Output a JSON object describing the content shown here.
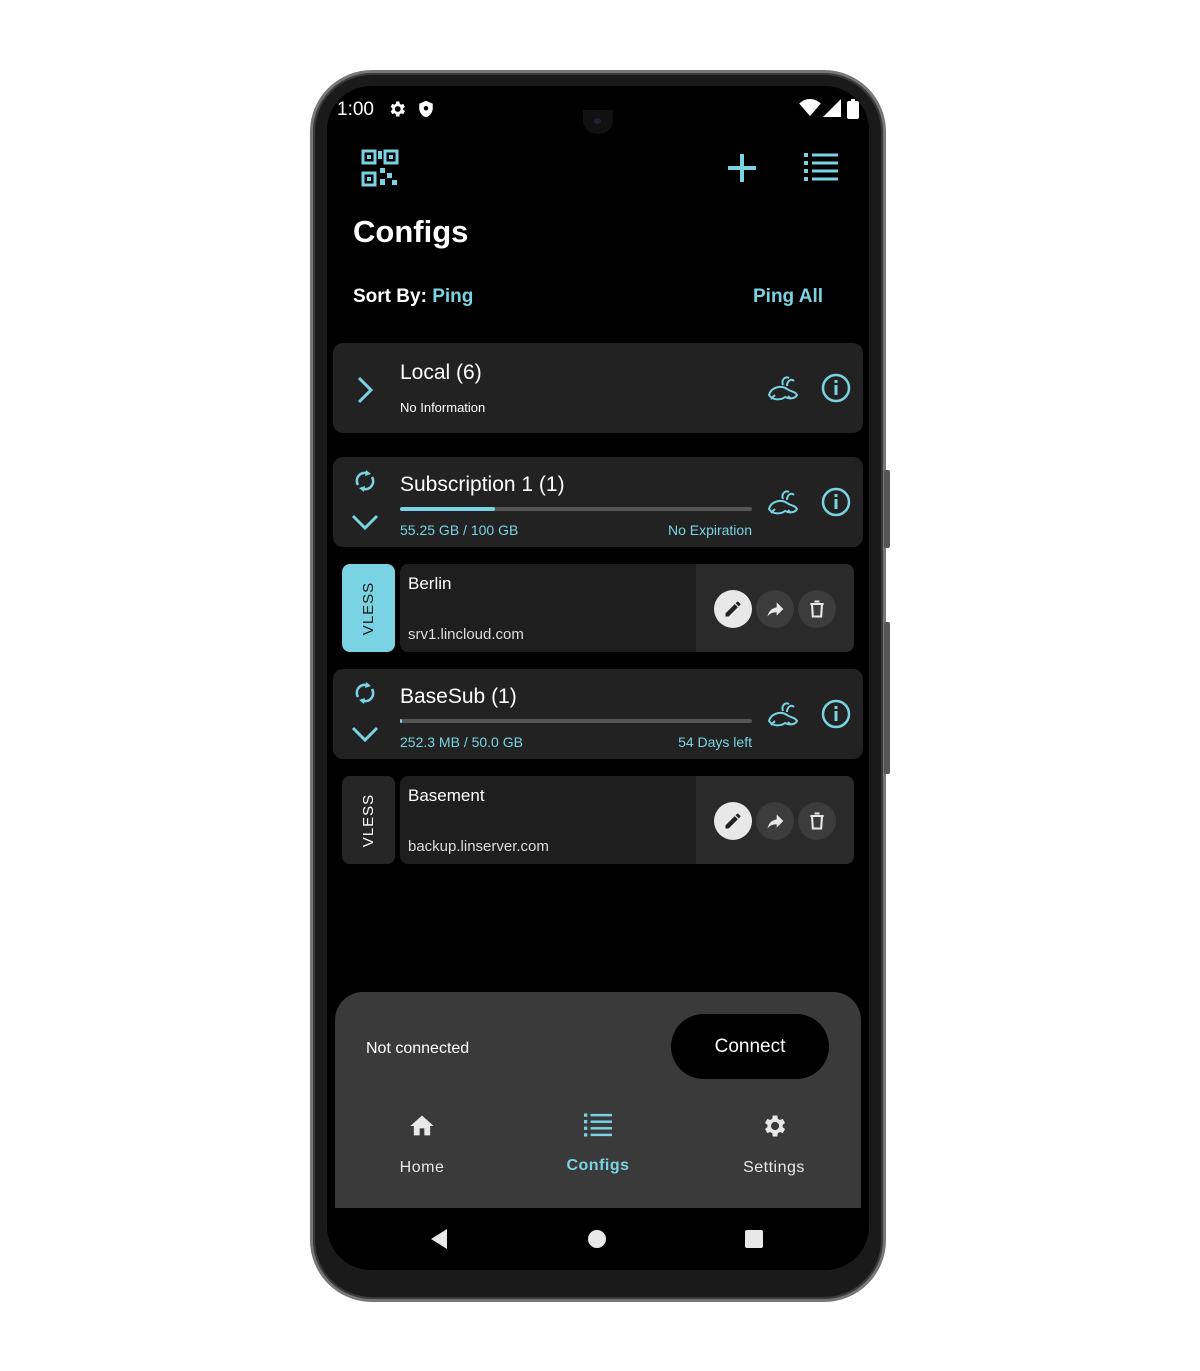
{
  "status_bar": {
    "time": "1:00"
  },
  "header": {
    "title": "Configs",
    "sort_label": "Sort By:",
    "sort_value": "Ping",
    "ping_all": "Ping All"
  },
  "icons": {
    "qr": "qr-code-icon",
    "add": "plus-icon",
    "list": "list-icon",
    "expand": "chevron-right-icon",
    "collapse": "chevron-down-icon",
    "refresh": "refresh-icon",
    "ping": "rabbit-icon",
    "info": "info-icon",
    "edit": "pencil-icon",
    "share": "share-icon",
    "delete": "trash-icon"
  },
  "groups": [
    {
      "name": "Local (6)",
      "info": "No Information"
    },
    {
      "name": "Subscription 1 (1)",
      "usage": "55.25 GB / 100 GB",
      "expiry": "No Expiration",
      "progress": 0.27
    },
    {
      "name": "BaseSub (1)",
      "usage": "252.3 MB / 50.0 GB",
      "expiry": "54 Days left",
      "progress": 0.005
    }
  ],
  "configs": [
    {
      "protocol": "VLESS",
      "name": "Berlin",
      "host": "srv1.lincloud.com",
      "selected": true
    },
    {
      "protocol": "VLESS",
      "name": "Basement",
      "host": "backup.linserver.com",
      "selected": false
    }
  ],
  "connection": {
    "status": "Not connected",
    "button": "Connect"
  },
  "bottom_nav": [
    {
      "label": "Home",
      "icon": "home-icon"
    },
    {
      "label": "Configs",
      "icon": "list-icon",
      "active": true
    },
    {
      "label": "Settings",
      "icon": "gear-icon"
    }
  ],
  "colors": {
    "accent": "#7ad3e3",
    "surface": "#222222",
    "background": "#000000",
    "sheet": "#3a3a3a"
  }
}
